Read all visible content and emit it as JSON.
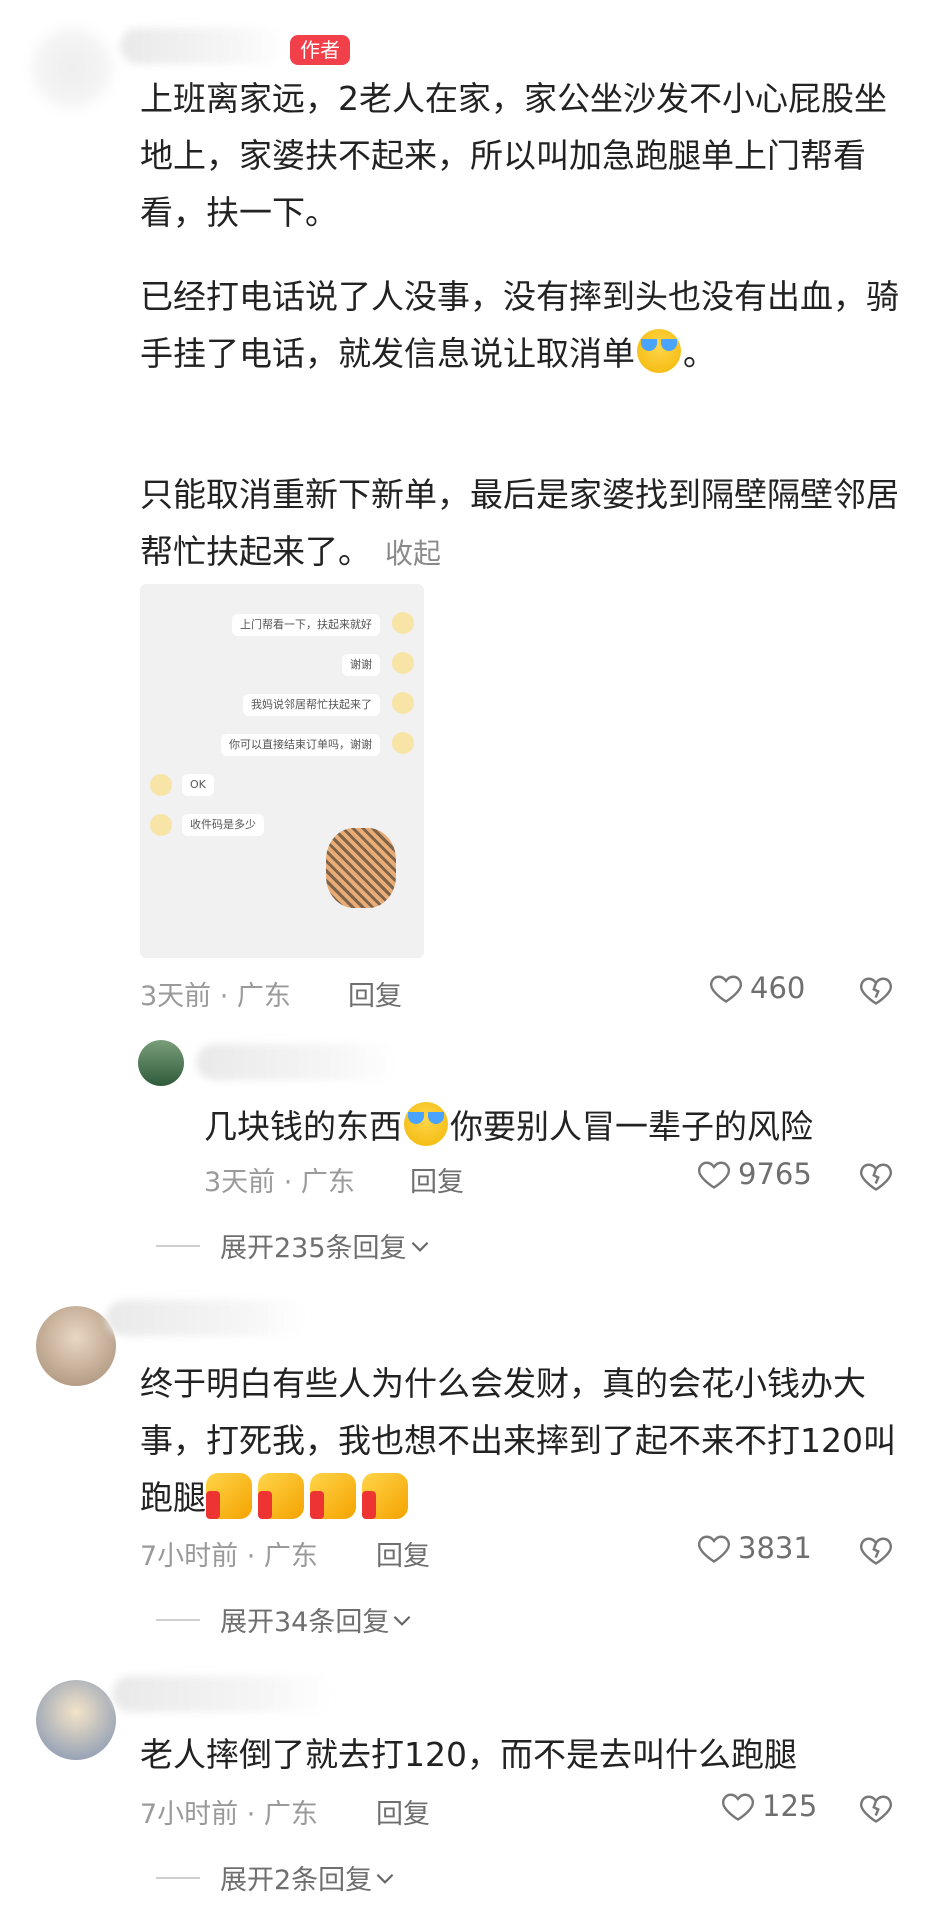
{
  "post": {
    "author_badge": "作者",
    "para1": "上班离家远，2老人在家，家公坐沙发不小心屁股坐地上，家婆扶不起来，所以叫加急跑腿单上门帮看看，扶一下。",
    "para2_a": "已经打电话说了人没事，没有摔到头也没有出血，骑手挂了电话，就发信息说让取消单",
    "para2_b": "。",
    "para3": "只能取消重新下新单，最后是家婆找到隔壁隔壁邻居帮忙扶起来了。",
    "collapse_label": "收起",
    "image": {
      "messages": [
        "上门帮看一下，扶起来就好",
        "谢谢",
        "我妈说邻居帮忙扶起来了",
        "你可以直接结束订单吗，谢谢",
        "OK",
        "收件码是多少"
      ]
    },
    "meta": "3天前 · 广东",
    "reply_label": "回复",
    "likes": "460"
  },
  "comments": [
    {
      "text_a": "几块钱的东西",
      "text_b": "你要别人冒一辈子的风险",
      "meta": "3天前 · 广东",
      "reply_label": "回复",
      "likes": "9765",
      "expand": "展开235条回复"
    },
    {
      "text": "终于明白有些人为什么会发财，真的会花小钱办大事，打死我，我也想不出来摔到了起不来不打120叫跑腿",
      "meta": "7小时前 · 广东",
      "reply_label": "回复",
      "likes": "3831",
      "expand": "展开34条回复"
    },
    {
      "text": "老人摔倒了就去打120，而不是去叫什么跑腿",
      "meta": "7小时前 · 广东",
      "reply_label": "回复",
      "likes": "125",
      "expand": "展开2条回复"
    }
  ],
  "icons": {
    "heart": "heart-outline-icon",
    "dislike": "broken-heart-icon",
    "expand": "chevron-down-icon",
    "emoji_cry": "laughing-crying-emoji",
    "thumb": "thumbs-up-emoji"
  },
  "colors": {
    "badge": "#f2404a",
    "meta": "#9a9a9a",
    "text": "#222222"
  }
}
